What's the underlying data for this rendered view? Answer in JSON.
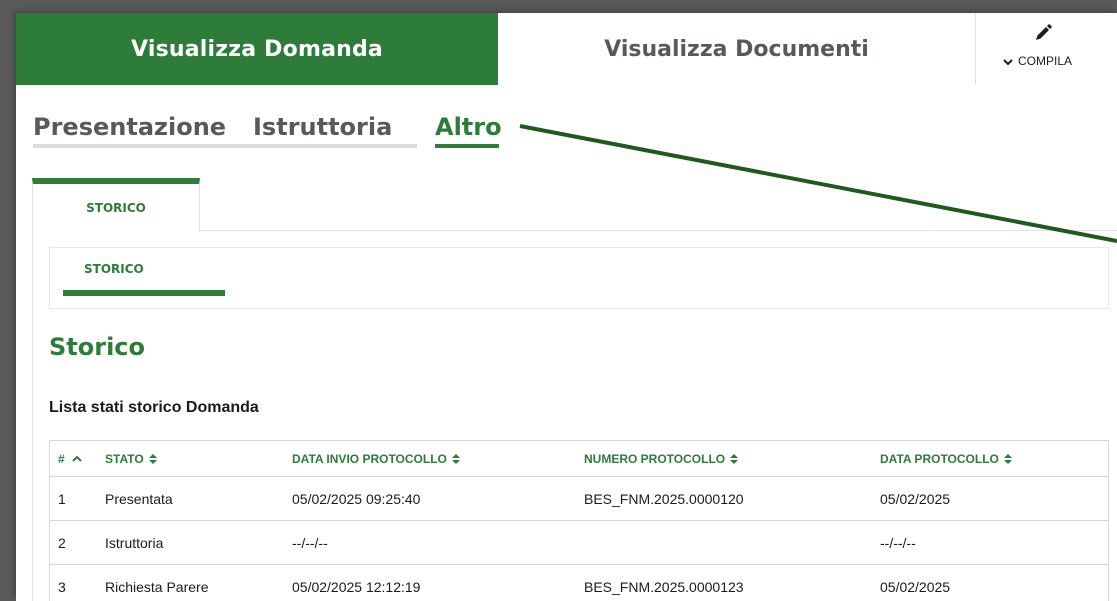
{
  "header": {
    "tab_domanda": "Visualizza Domanda",
    "tab_documenti": "Visualizza Documenti",
    "compila_label": "COMPILA",
    "compila_icon": "pencil-icon"
  },
  "subtabs": {
    "presentazione": "Presentazione",
    "istruttoria": "Istruttoria",
    "altro": "Altro"
  },
  "tab_storico": "STORICO",
  "inner_tab_storico": "STORICO",
  "section_title": "Storico",
  "table_title": "Lista stati storico Domanda",
  "table": {
    "headers": {
      "num": "#",
      "stato": "STATO",
      "data_invio": "DATA INVIO PROTOCOLLO",
      "numero": "NUMERO PROTOCOLLO",
      "data_prot": "DATA PROTOCOLLO"
    },
    "sort_asc_symbol": "^",
    "sort_symbol": "⬍",
    "rows": [
      {
        "num": "1",
        "stato": "Presentata",
        "data_invio": "05/02/2025 09:25:40",
        "numero": "BES_FNM.2025.0000120",
        "data_prot": "05/02/2025"
      },
      {
        "num": "2",
        "stato": "Istruttoria",
        "data_invio": "--/--/--",
        "numero": "",
        "data_prot": "--/--/--"
      },
      {
        "num": "3",
        "stato": "Richiesta Parere",
        "data_invio": "05/02/2025 12:12:19",
        "numero": "BES_FNM.2025.0000123",
        "data_prot": "05/02/2025"
      }
    ]
  },
  "colors": {
    "brand_green": "#2d7c3a",
    "annotation_arrow": "#1e5a1e"
  }
}
